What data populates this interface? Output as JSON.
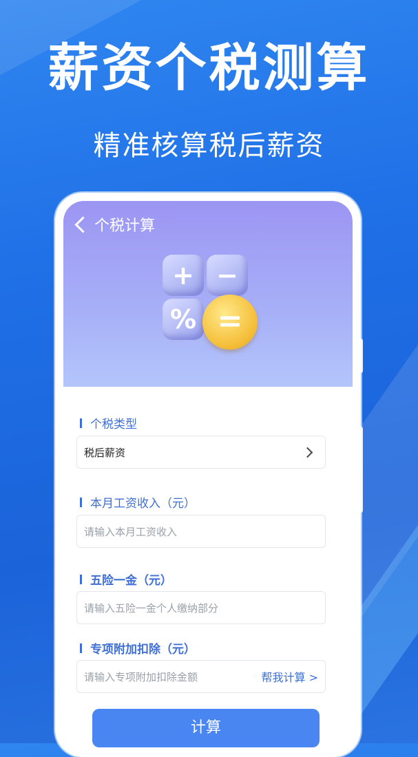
{
  "promo": {
    "title": "薪资个税测算",
    "subtitle": "精准核算税后薪资"
  },
  "app": {
    "nav_title": "个税计算",
    "calculator_keys": [
      "+",
      "−",
      "%",
      "="
    ],
    "sections": [
      {
        "label": "个税类型",
        "value": "税后薪资",
        "placeholder": ""
      },
      {
        "label": "本月工资收入（元）",
        "value": "",
        "placeholder": "请输入本月工资收入"
      },
      {
        "label": "五险一金（元）",
        "value": "",
        "placeholder": "请输入五险一金个人缴纳部分"
      },
      {
        "label": "专项附加扣除（元）",
        "value": "",
        "placeholder": "请输入专项附加扣除金额",
        "help_link": "帮我计算 >"
      }
    ],
    "submit_label": "计算"
  },
  "colors": {
    "background": "#1f6fe6",
    "accent": "#3d6fd6",
    "button": "#4a86f2",
    "header_top": "#9c95f3",
    "header_bottom": "#b4c5fb",
    "coin": "#f6c240"
  }
}
